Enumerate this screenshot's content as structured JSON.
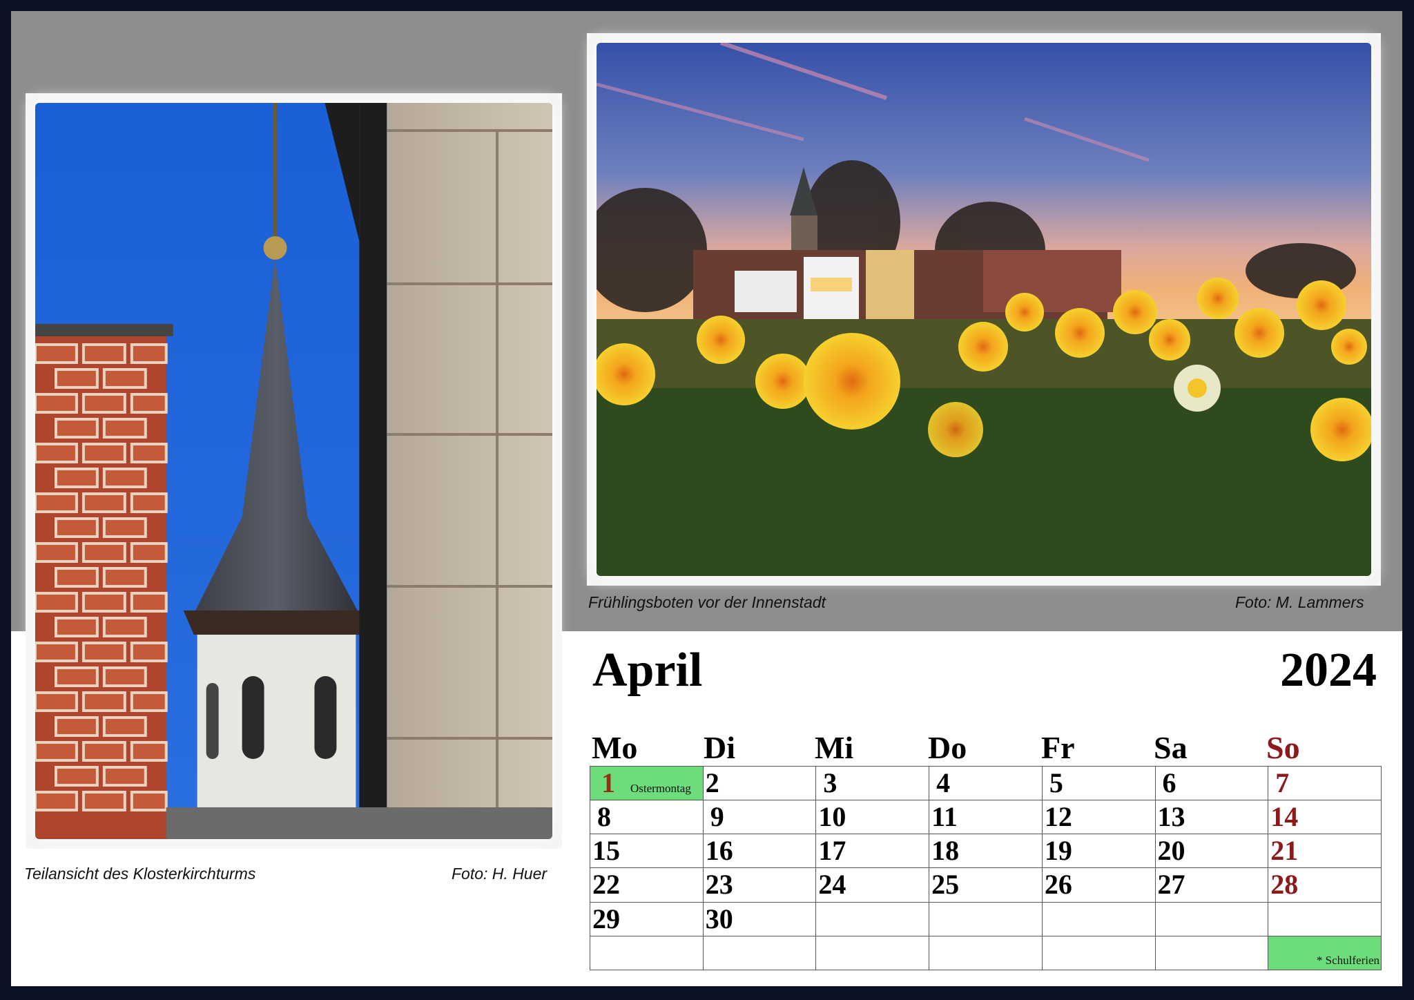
{
  "photos": {
    "left": {
      "caption": "Teilansicht des Klosterkirchturms",
      "credit": "Foto: H. Huer"
    },
    "right": {
      "caption": "Frühlingsboten vor der Innenstadt",
      "credit": "Foto: M. Lammers"
    }
  },
  "calendar": {
    "month": "April",
    "year": "2024",
    "weekdays": [
      "Mo",
      "Di",
      "Mi",
      "Do",
      "Fr",
      "Sa",
      "So"
    ],
    "weeks": [
      [
        "1",
        "2",
        "3",
        "4",
        "5",
        "6",
        "7"
      ],
      [
        "8",
        "9",
        "10",
        "11",
        "12",
        "13",
        "14"
      ],
      [
        "15",
        "16",
        "17",
        "18",
        "19",
        "20",
        "21"
      ],
      [
        "22",
        "23",
        "24",
        "25",
        "26",
        "27",
        "28"
      ],
      [
        "29",
        "30",
        "",
        "",
        "",
        "",
        ""
      ],
      [
        "",
        "",
        "",
        "",
        "",
        "",
        ""
      ]
    ],
    "holiday_label": "Ostermontag",
    "ferien_label": "* Schulferien"
  },
  "colors": {
    "sunday": "#8b1a1a",
    "highlight": "#6ddc7a",
    "background_band": "#8e8e8e",
    "border": "#0b1226"
  }
}
